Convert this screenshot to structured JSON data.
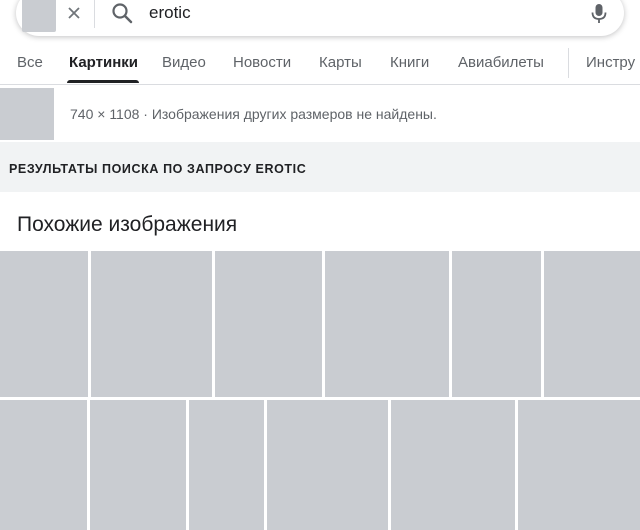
{
  "search": {
    "query": "erotic",
    "clear_icon": "close-icon",
    "search_icon": "search-icon",
    "mic_icon": "mic-icon"
  },
  "tabs": [
    {
      "label": "Все",
      "active": false
    },
    {
      "label": "Картинки",
      "active": true
    },
    {
      "label": "Видео",
      "active": false
    },
    {
      "label": "Новости",
      "active": false
    },
    {
      "label": "Карты",
      "active": false
    },
    {
      "label": "Книги",
      "active": false
    },
    {
      "label": "Авиабилеты",
      "active": false
    },
    {
      "label": "Инстру",
      "active": false
    }
  ],
  "source": {
    "info": "740 × 1108 · Изображения других размеров не найдены."
  },
  "results_band": "РЕЗУЛЬТАТЫ ПОИСКА ПО ЗАПРОСУ EROTIC",
  "similar": {
    "title": "Похожие изображения",
    "row_count": 2,
    "row1_count": 6,
    "row2_count": 6
  },
  "colors": {
    "accent": "#202124",
    "muted": "#5f6368",
    "band": "#f1f3f4",
    "placeholder": "#c9ccd1"
  }
}
